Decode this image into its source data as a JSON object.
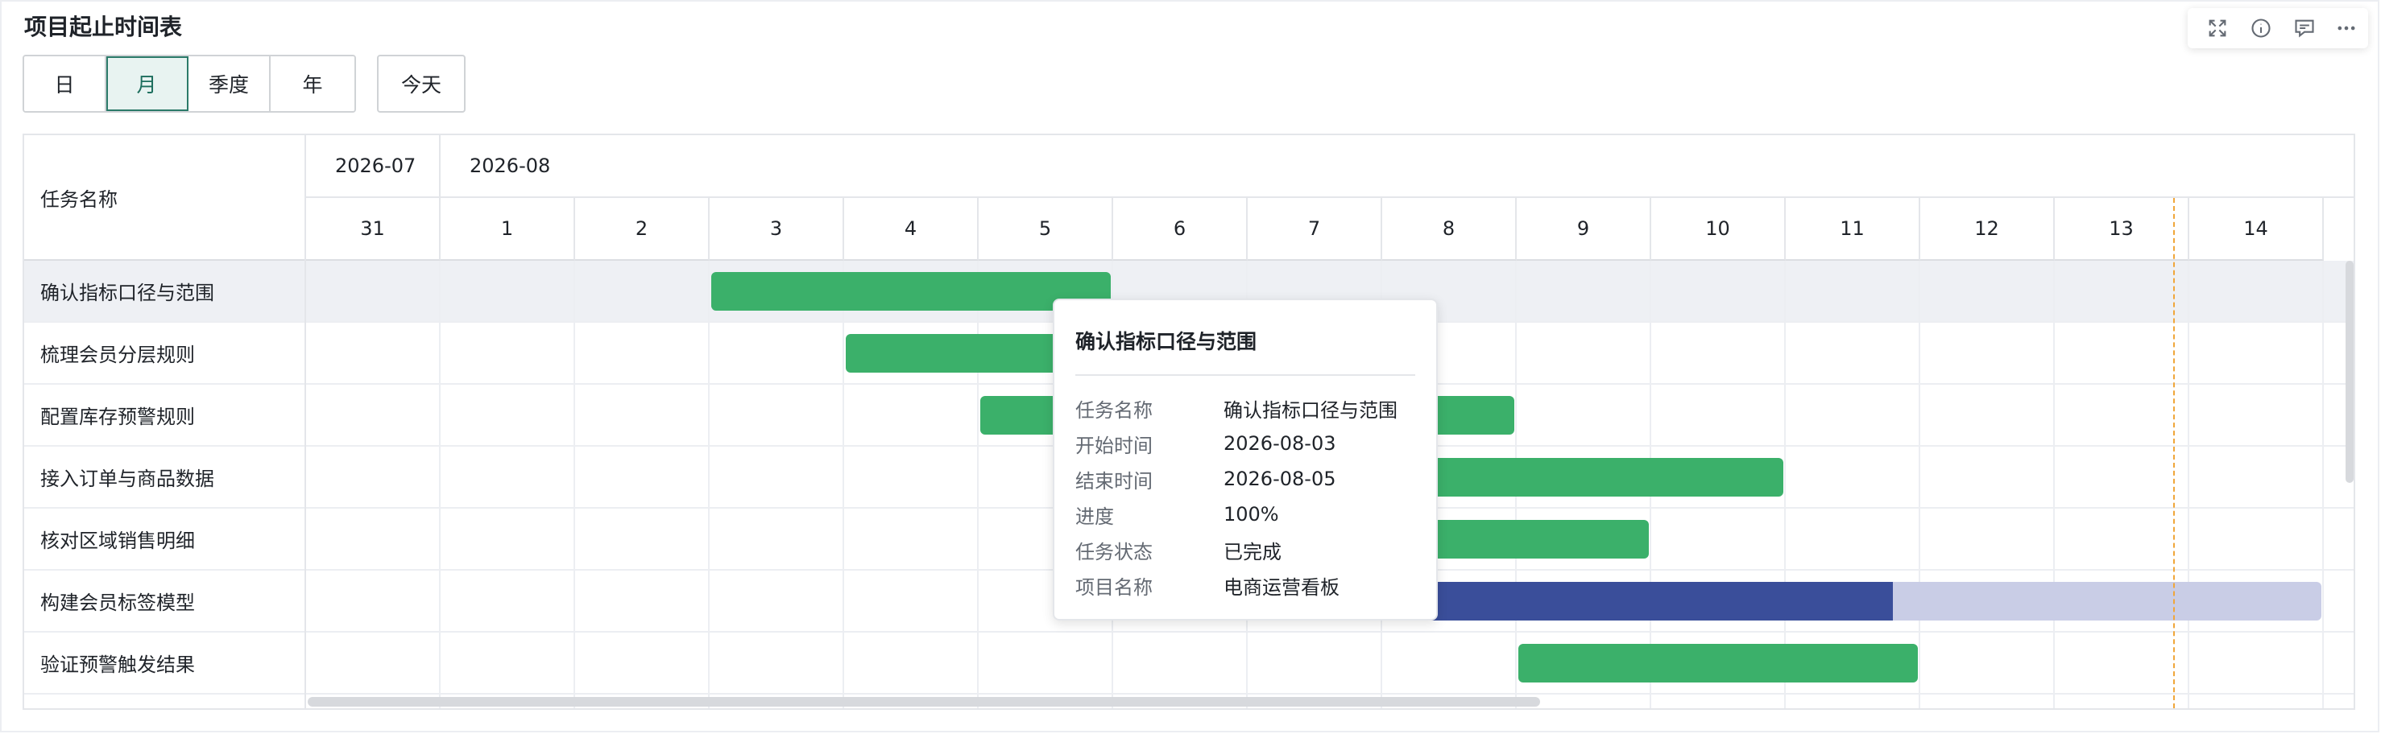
{
  "title": "项目起止时间表",
  "view_modes": [
    {
      "label": "日",
      "active": false
    },
    {
      "label": "月",
      "active": true
    },
    {
      "label": "季度",
      "active": false
    },
    {
      "label": "年",
      "active": false
    }
  ],
  "today_label": "今天",
  "toolbar_icons": [
    "fullscreen-icon",
    "info-icon",
    "comment-icon",
    "more-icon"
  ],
  "grid": {
    "task_header": "任务名称",
    "months": [
      "2026-07",
      "2026-08"
    ],
    "days": [
      "31",
      "1",
      "2",
      "3",
      "4",
      "5",
      "6",
      "7",
      "8",
      "9",
      "10",
      "11",
      "12",
      "13",
      "14"
    ]
  },
  "tasks": [
    {
      "name": "确认指标口径与范围",
      "start": "2026-08-03",
      "end": "2026-08-05",
      "progress": 1.0,
      "highlighted": true
    },
    {
      "name": "梳理会员分层规则",
      "start": "2026-08-04",
      "end": "2026-08-05",
      "progress": 1.0,
      "highlighted": false
    },
    {
      "name": "配置库存预警规则",
      "start": "2026-08-05",
      "end": "2026-08-08",
      "progress": 1.0,
      "highlighted": false
    },
    {
      "name": "接入订单与商品数据",
      "start": "2026-08-07",
      "end": "2026-08-10",
      "progress": 1.0,
      "highlighted": false
    },
    {
      "name": "核对区域销售明细",
      "start": "2026-08-07",
      "end": "2026-08-09",
      "progress": 1.0,
      "highlighted": false
    },
    {
      "name": "构建会员标签模型",
      "start": "2026-08-07",
      "end": "2026-08-14",
      "progress": 0.6,
      "highlighted": false
    },
    {
      "name": "验证预警触发结果",
      "start": "2026-08-09",
      "end": "2026-08-11",
      "progress": 1.0,
      "highlighted": false
    }
  ],
  "today": "2026-08-13",
  "colors": {
    "done": "#3bb06a",
    "in_progress": "#3a4e9a",
    "remaining": "#c9cde6",
    "today_line": "#f0a63a",
    "active_mode": "#2b7a69"
  },
  "tooltip": {
    "title": "确认指标口径与范围",
    "rows": [
      {
        "key": "任务名称",
        "value": "确认指标口径与范围"
      },
      {
        "key": "开始时间",
        "value": "2026-08-03"
      },
      {
        "key": "结束时间",
        "value": "2026-08-05"
      },
      {
        "key": "进度",
        "value": "100%"
      },
      {
        "key": "任务状态",
        "value": "已完成"
      },
      {
        "key": "项目名称",
        "value": "电商运营看板"
      }
    ]
  }
}
